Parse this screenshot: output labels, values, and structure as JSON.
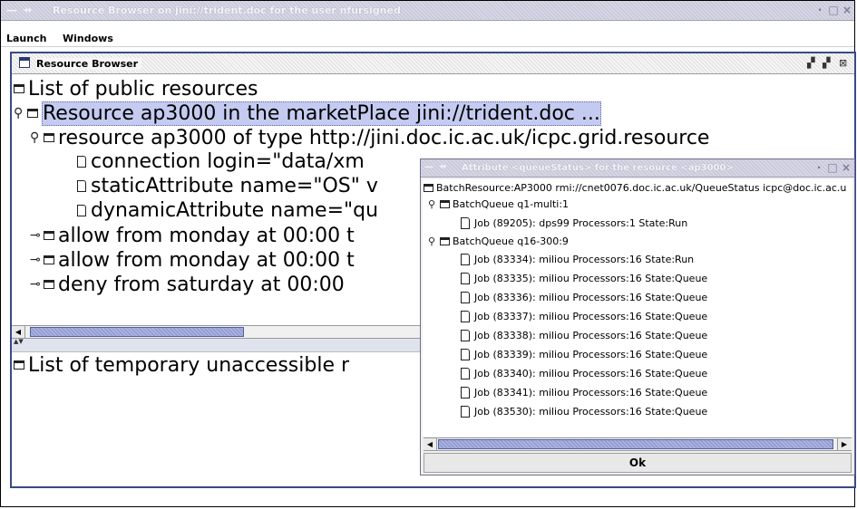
{
  "main_window": {
    "title": "Resource Browser on jini://trident.doc for the user nfursigned",
    "controls": {
      "minimize": "·",
      "maximize": "□",
      "close": "×"
    }
  },
  "menu": {
    "items": [
      "Launch",
      "Windows"
    ]
  },
  "internal_frame": {
    "title": "Resource Browser"
  },
  "top_tree": {
    "root": "List of public resources",
    "resource": "Resource ap3000 in the marketPlace jini://trident.doc ...",
    "resource_type": "resource ap3000 of type http://jini.doc.ic.ac.uk/icpc.grid.resource",
    "connection": "connection login=\"data/xm",
    "static_attr": "staticAttribute name=\"OS\" v",
    "dynamic_attr": "dynamicAttribute name=\"qu",
    "allow1": "allow from monday at 00:00 t",
    "allow2": "allow from monday at 00:00 t",
    "deny": "deny from saturday at 00:00"
  },
  "bottom_tree": {
    "root": "List of temporary unaccessible r"
  },
  "attr_dialog": {
    "title": "Attribute <queueStatus> for the resource <ap3000>",
    "root": "BatchResource:AP3000 rmi://cnet0076.doc.ic.ac.uk/QueueStatus icpc@doc.ic.ac.u",
    "queue1": "BatchQueue q1-multi:1",
    "queue1_jobs": [
      "Job (89205): dps99 Processors:1 State:Run"
    ],
    "queue2": "BatchQueue q16-300:9",
    "queue2_jobs": [
      "Job (83334): miliou Processors:16 State:Run",
      "Job (83335): miliou Processors:16 State:Queue",
      "Job (83336): miliou Processors:16 State:Queue",
      "Job (83337): miliou Processors:16 State:Queue",
      "Job (83338): miliou Processors:16 State:Queue",
      "Job (83339): miliou Processors:16 State:Queue",
      "Job (83340): miliou Processors:16 State:Queue",
      "Job (83341): miliou Processors:16 State:Queue",
      "Job (83530): miliou Processors:16 State:Queue"
    ],
    "ok_label": "Ok"
  }
}
